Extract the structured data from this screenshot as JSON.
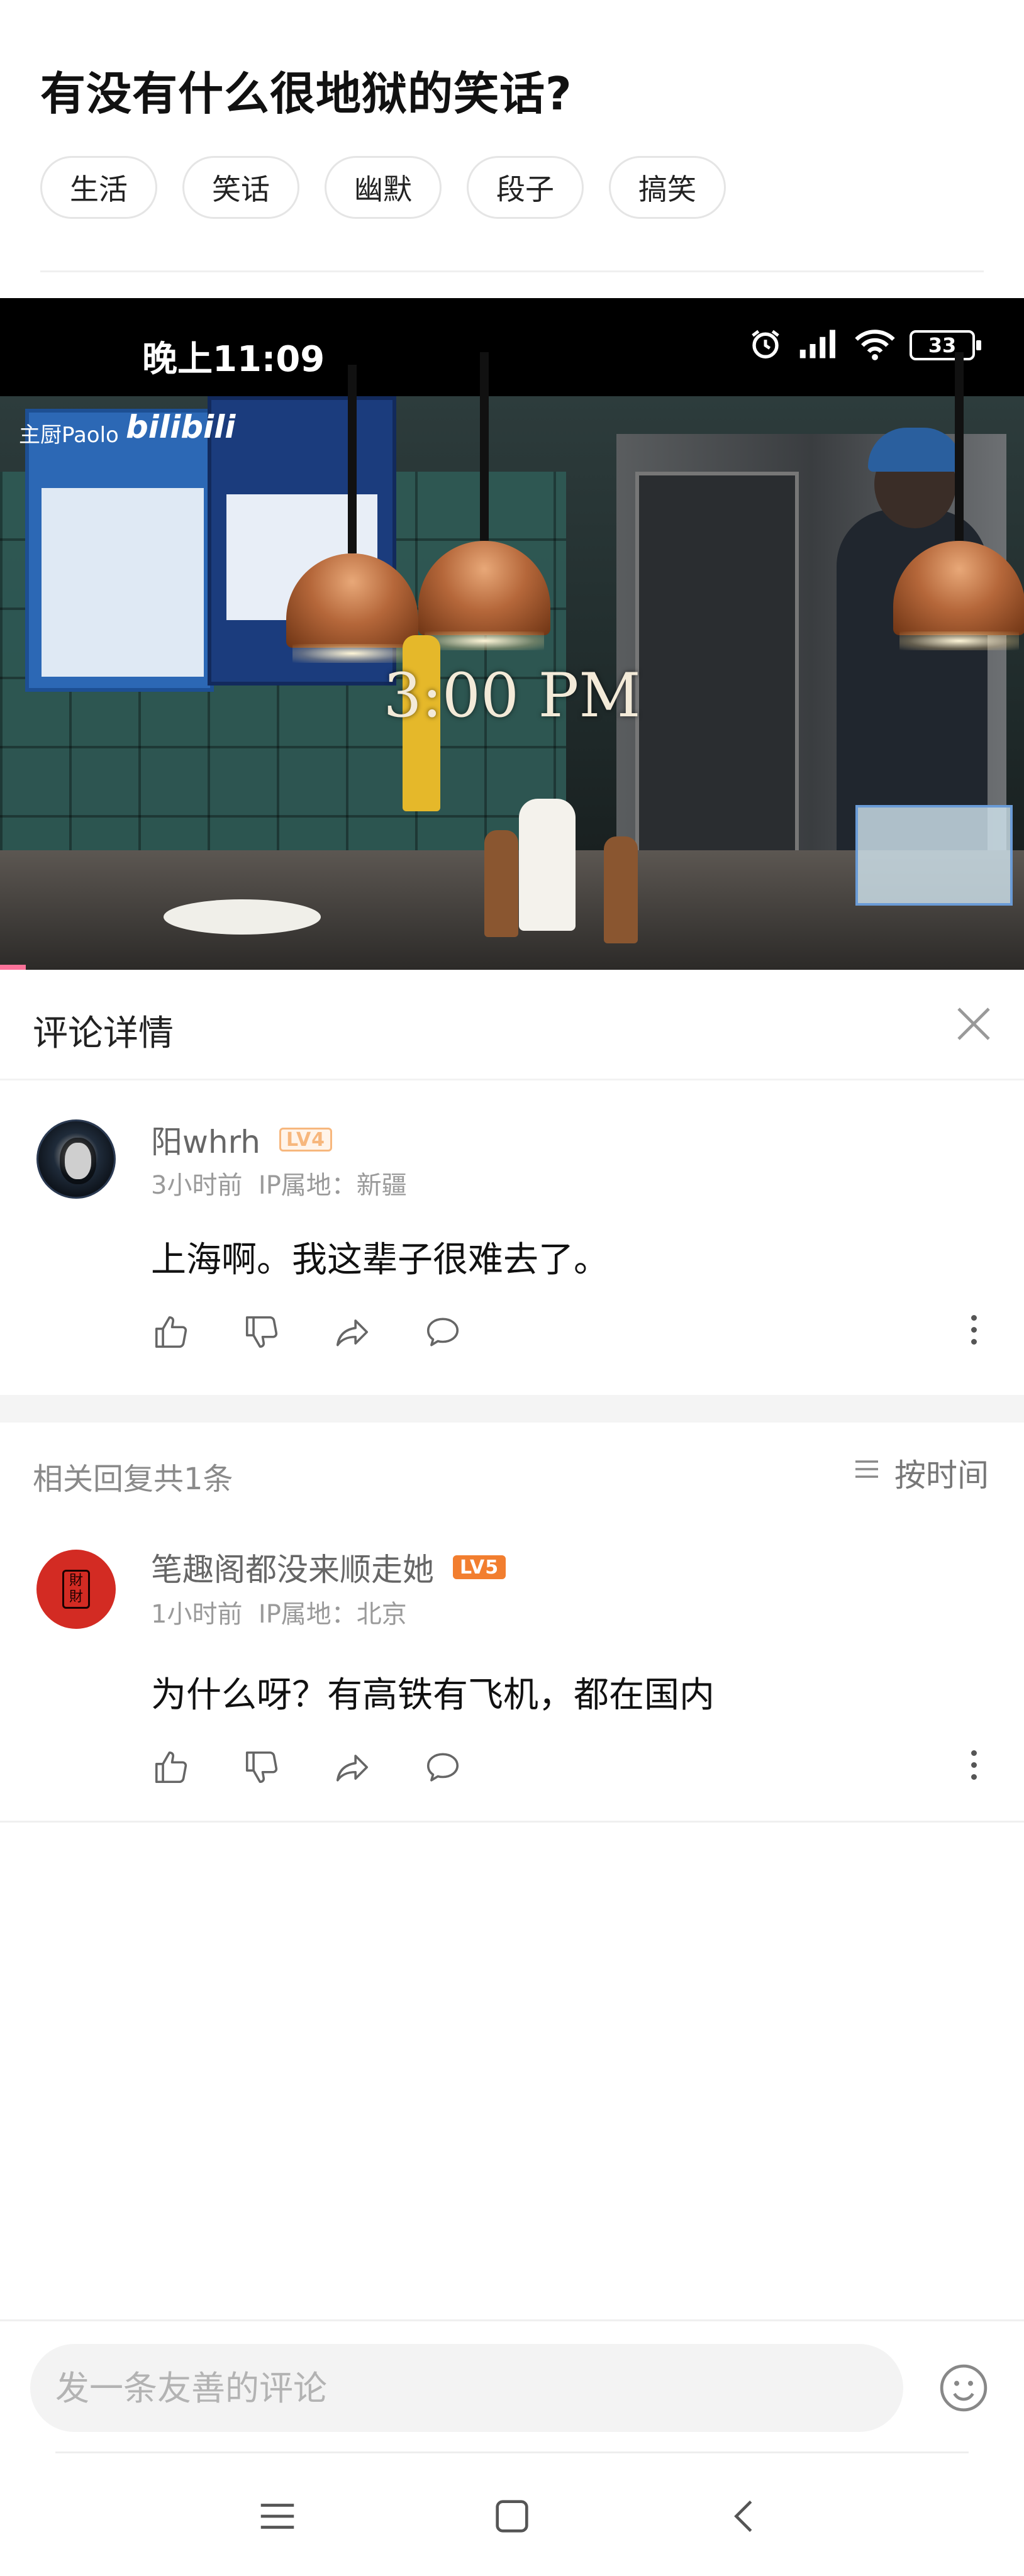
{
  "question": {
    "title": "有没有什么很地狱的笑话?",
    "tags": [
      "生活",
      "笑话",
      "幽默",
      "段子",
      "搞笑"
    ]
  },
  "video": {
    "status_time": "晚上11:09",
    "battery": "33",
    "logo_text": "主厨Paolo",
    "logo_brand": "bilibili",
    "time_overlay": "3:00 PM",
    "progress": 0.025,
    "accent_color": "#fb7299"
  },
  "detail": {
    "title": "评论详情",
    "close_icon": "close-icon"
  },
  "main_comment": {
    "username": "阳whrh",
    "level": "LV4",
    "time": "3小时前",
    "ip": "IP属地：新疆",
    "text": "上海啊。我这辈子很难去了。"
  },
  "replies": {
    "count_label": "相关回复共1条",
    "sort_label": "按时间",
    "items": [
      {
        "username": "笔趣阁都没来顺走她",
        "level": "LV5",
        "time": "1小时前",
        "ip": "IP属地：北京",
        "text": "为什么呀？有高铁有飞机，都在国内"
      }
    ]
  },
  "input": {
    "placeholder": "发一条友善的评论"
  },
  "colors": {
    "lv4": "#f7b77d",
    "lv5": "#f27e2f",
    "avatar_red": "#d32b23"
  }
}
